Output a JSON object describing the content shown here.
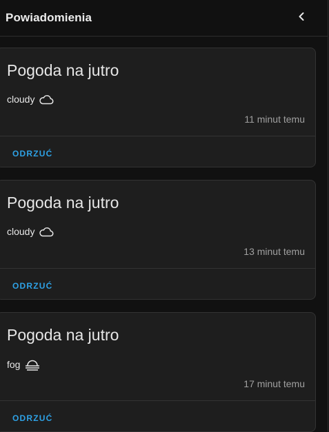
{
  "header": {
    "title": "Powiadomienia"
  },
  "notifications": [
    {
      "title": "Pogoda na jutro",
      "message": "cloudy",
      "icon": "cloud-icon",
      "time": "11 minut temu",
      "dismiss_label": "ODRZUĆ"
    },
    {
      "title": "Pogoda na jutro",
      "message": "cloudy",
      "icon": "cloud-icon",
      "time": "13 minut temu",
      "dismiss_label": "ODRZUĆ"
    },
    {
      "title": "Pogoda na jutro",
      "message": "fog",
      "icon": "fog-icon",
      "time": "17 minut temu",
      "dismiss_label": "ODRZUĆ"
    }
  ],
  "colors": {
    "accent": "#2ea2e6",
    "card_background": "#1e1e1e",
    "page_background": "#111111"
  }
}
